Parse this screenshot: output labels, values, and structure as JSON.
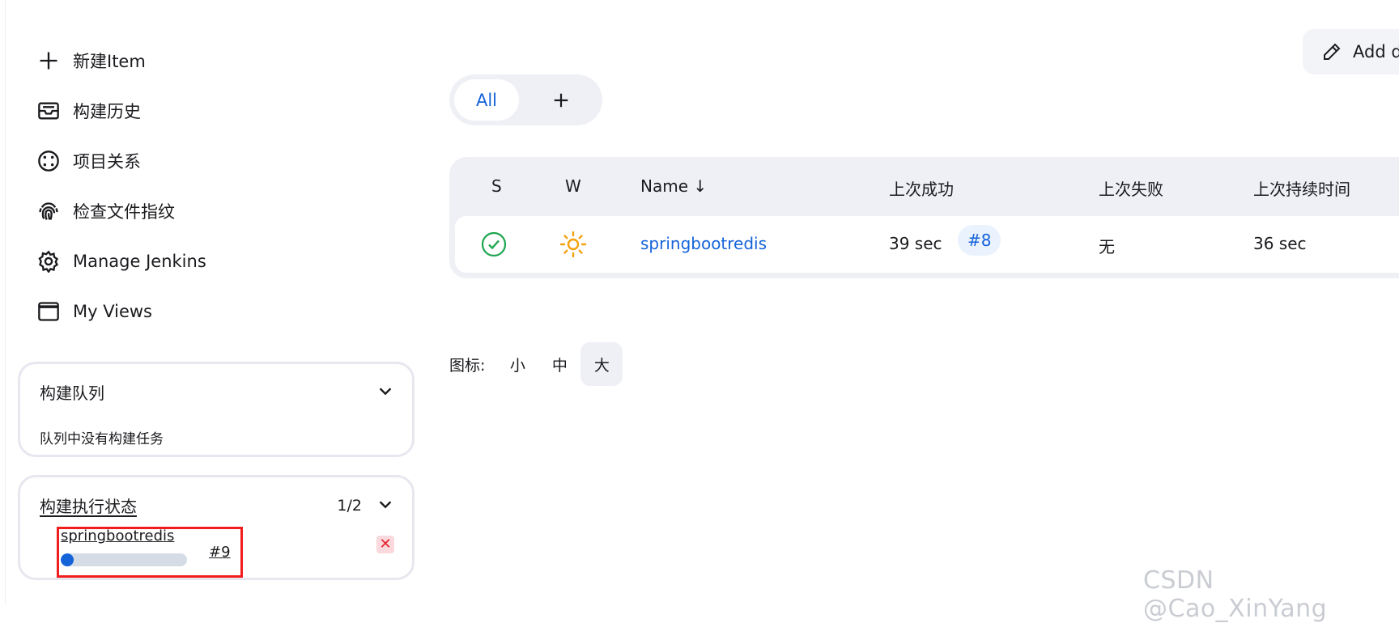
{
  "sidebar": {
    "items": [
      {
        "label": "新建Item",
        "icon": "plus-icon"
      },
      {
        "label": "构建历史",
        "icon": "inbox-icon"
      },
      {
        "label": "项目关系",
        "icon": "relationship-icon"
      },
      {
        "label": "检查文件指纹",
        "icon": "fingerprint-icon"
      },
      {
        "label": "Manage Jenkins",
        "icon": "gear-icon"
      },
      {
        "label": "My Views",
        "icon": "window-icon"
      }
    ]
  },
  "queue": {
    "title": "构建队列",
    "empty_text": "队列中没有构建任务"
  },
  "executors": {
    "title": "构建执行状态",
    "count": "1/2",
    "job": "springbootredis",
    "build": "#9",
    "progress": 0.08
  },
  "toolbar": {
    "add_description": "Add d"
  },
  "tabs": {
    "active": "All"
  },
  "table": {
    "headers": {
      "s": "S",
      "w": "W",
      "name": "Name ↓",
      "last_success": "上次成功",
      "last_failure": "上次失败",
      "last_duration": "上次持续时间"
    },
    "rows": [
      {
        "name": "springbootredis",
        "last_success": "39 sec",
        "last_success_build": "#8",
        "last_failure": "无",
        "last_duration": "36 sec"
      }
    ]
  },
  "icon_size": {
    "label": "图标:",
    "small": "小",
    "medium": "中",
    "large": "大"
  },
  "watermark": "CSDN @Cao_XinYang",
  "colors": {
    "accent": "#1463d9",
    "success": "#1ea64f",
    "weather": "#f3a20d",
    "highlight": "#f21d1d"
  }
}
